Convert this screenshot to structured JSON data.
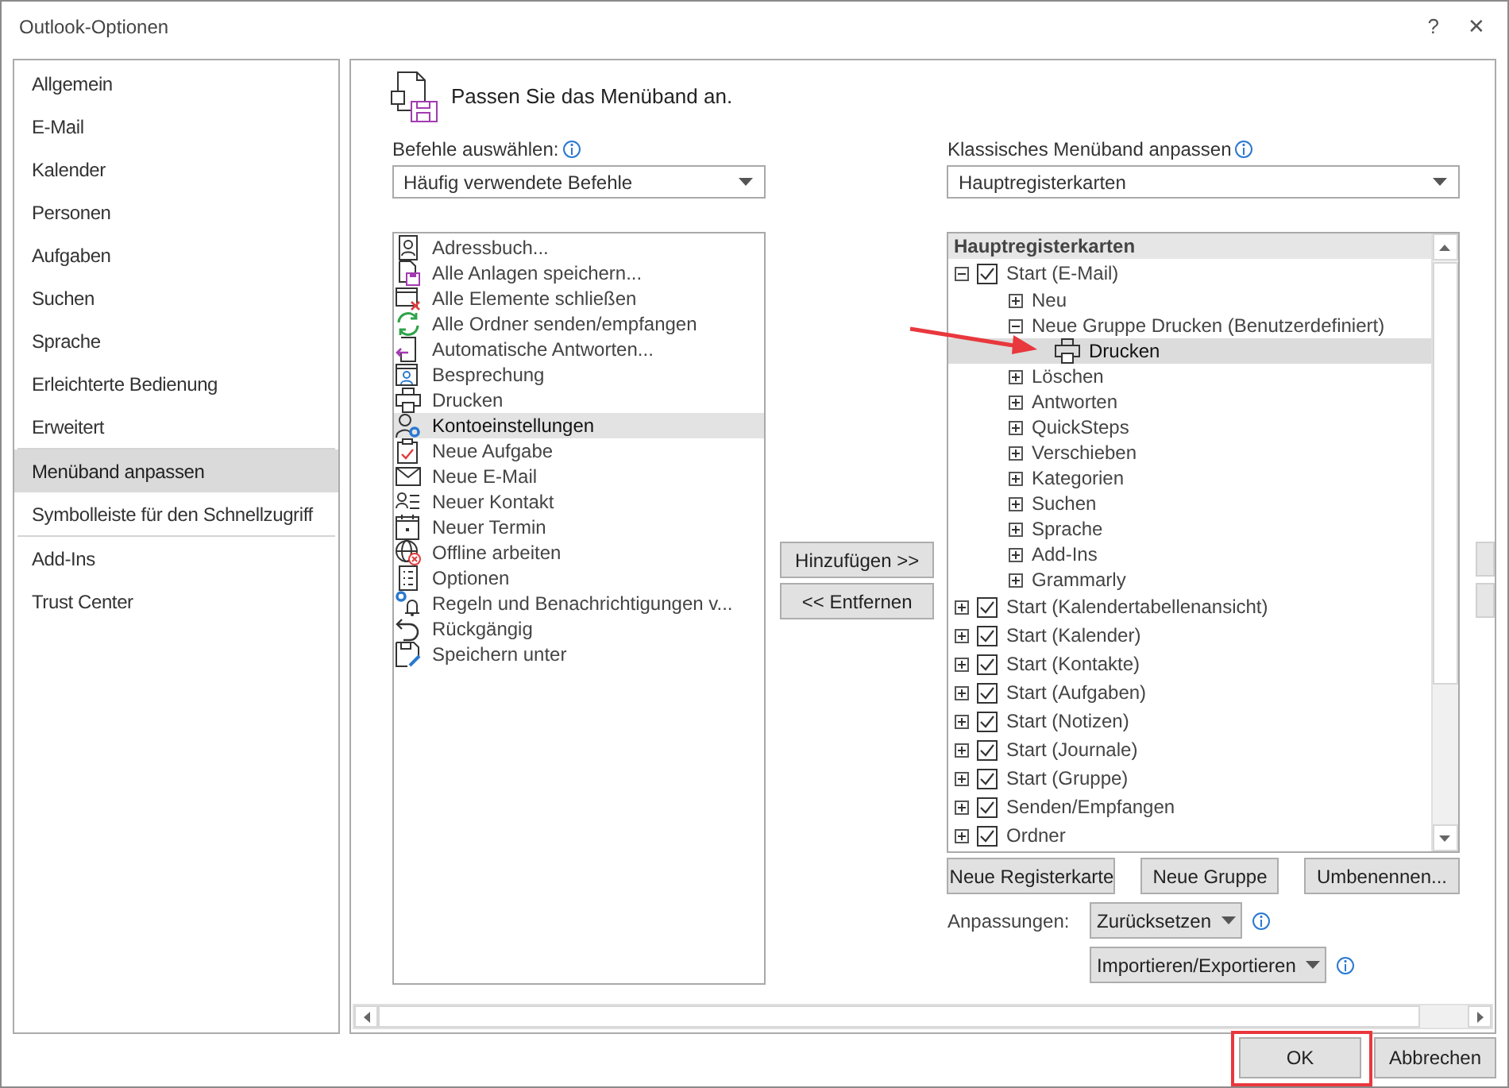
{
  "window": {
    "title": "Outlook-Optionen",
    "help": "?",
    "close": "✕"
  },
  "sidebar": {
    "groups": [
      {
        "items": [
          {
            "label": "Allgemein",
            "selected": false
          },
          {
            "label": "E-Mail",
            "selected": false
          },
          {
            "label": "Kalender",
            "selected": false
          },
          {
            "label": "Personen",
            "selected": false
          },
          {
            "label": "Aufgaben",
            "selected": false
          },
          {
            "label": "Suchen",
            "selected": false
          },
          {
            "label": "Sprache",
            "selected": false
          },
          {
            "label": "Erleichterte Bedienung",
            "selected": false
          },
          {
            "label": "Erweitert",
            "selected": false
          }
        ]
      },
      {
        "items": [
          {
            "label": "Menüband anpassen",
            "selected": true
          },
          {
            "label": "Symbolleiste für den Schnellzugriff",
            "selected": false
          }
        ]
      },
      {
        "items": [
          {
            "label": "Add-Ins",
            "selected": false
          },
          {
            "label": "Trust Center",
            "selected": false
          }
        ]
      }
    ]
  },
  "main": {
    "heading": "Passen Sie das Menüband an.",
    "commands_label": "Befehle auswählen:",
    "commands_dropdown": "Häufig verwendete Befehle",
    "commands": [
      {
        "label": "Adressbuch...",
        "selected": false
      },
      {
        "label": "Alle Anlagen speichern...",
        "selected": false
      },
      {
        "label": "Alle Elemente schließen",
        "selected": false
      },
      {
        "label": "Alle Ordner senden/empfangen",
        "selected": false
      },
      {
        "label": "Automatische Antworten...",
        "selected": false
      },
      {
        "label": "Besprechung",
        "selected": false
      },
      {
        "label": "Drucken",
        "selected": false
      },
      {
        "label": "Kontoeinstellungen",
        "selected": true
      },
      {
        "label": "Neue Aufgabe",
        "selected": false
      },
      {
        "label": "Neue E-Mail",
        "selected": false
      },
      {
        "label": "Neuer Kontakt",
        "selected": false
      },
      {
        "label": "Neuer Termin",
        "selected": false
      },
      {
        "label": "Offline arbeiten",
        "selected": false
      },
      {
        "label": "Optionen",
        "selected": false
      },
      {
        "label": "Regeln und Benachrichtigungen v...",
        "selected": false
      },
      {
        "label": "Rückgängig",
        "selected": false
      },
      {
        "label": "Speichern unter",
        "selected": false
      }
    ],
    "add_button": "Hinzufügen >>",
    "remove_button": "<< Entfernen",
    "ribbon_label": "Klassisches Menüband anpassen",
    "ribbon_dropdown": "Hauptregisterkarten",
    "tree": {
      "heading": "Hauptregisterkarten",
      "items": [
        {
          "kind": "tab",
          "label": "Start (E-Mail)",
          "checked": true,
          "expanded": true,
          "selected": false,
          "children": [
            {
              "kind": "group",
              "label": "Neu",
              "expanded": false,
              "selected": false
            },
            {
              "kind": "group",
              "label": "Neue Gruppe Drucken (Benutzerdefiniert)",
              "expanded": true,
              "selected": false,
              "children": [
                {
                  "kind": "command",
                  "label": "Drucken",
                  "selected": true
                }
              ]
            },
            {
              "kind": "group",
              "label": "Löschen",
              "expanded": false,
              "selected": false
            },
            {
              "kind": "group",
              "label": "Antworten",
              "expanded": false,
              "selected": false
            },
            {
              "kind": "group",
              "label": "QuickSteps",
              "expanded": false,
              "selected": false
            },
            {
              "kind": "group",
              "label": "Verschieben",
              "expanded": false,
              "selected": false
            },
            {
              "kind": "group",
              "label": "Kategorien",
              "expanded": false,
              "selected": false
            },
            {
              "kind": "group",
              "label": "Suchen",
              "expanded": false,
              "selected": false
            },
            {
              "kind": "group",
              "label": "Sprache",
              "expanded": false,
              "selected": false
            },
            {
              "kind": "group",
              "label": "Add-Ins",
              "expanded": false,
              "selected": false
            },
            {
              "kind": "group",
              "label": "Grammarly",
              "expanded": false,
              "selected": false
            }
          ]
        },
        {
          "kind": "tab",
          "label": "Start (Kalendertabellenansicht)",
          "checked": true,
          "expanded": false,
          "selected": false
        },
        {
          "kind": "tab",
          "label": "Start (Kalender)",
          "checked": true,
          "expanded": false,
          "selected": false
        },
        {
          "kind": "tab",
          "label": "Start (Kontakte)",
          "checked": true,
          "expanded": false,
          "selected": false
        },
        {
          "kind": "tab",
          "label": "Start (Aufgaben)",
          "checked": true,
          "expanded": false,
          "selected": false
        },
        {
          "kind": "tab",
          "label": "Start (Notizen)",
          "checked": true,
          "expanded": false,
          "selected": false
        },
        {
          "kind": "tab",
          "label": "Start (Journale)",
          "checked": true,
          "expanded": false,
          "selected": false
        },
        {
          "kind": "tab",
          "label": "Start (Gruppe)",
          "checked": true,
          "expanded": false,
          "selected": false
        },
        {
          "kind": "tab",
          "label": "Senden/Empfangen",
          "checked": true,
          "expanded": false,
          "selected": false
        },
        {
          "kind": "tab",
          "label": "Ordner",
          "checked": true,
          "expanded": false,
          "selected": false
        }
      ]
    },
    "tree_buttons": [
      "Neue Registerkarte",
      "Neue Gruppe",
      "Umbenennen..."
    ],
    "customizations_label": "Anpassungen:",
    "reset_button": "Zurücksetzen",
    "import_export_button": "Importieren/Exportieren"
  },
  "footer": {
    "ok": "OK",
    "cancel": "Abbrechen",
    "ok_highlighted": true
  }
}
